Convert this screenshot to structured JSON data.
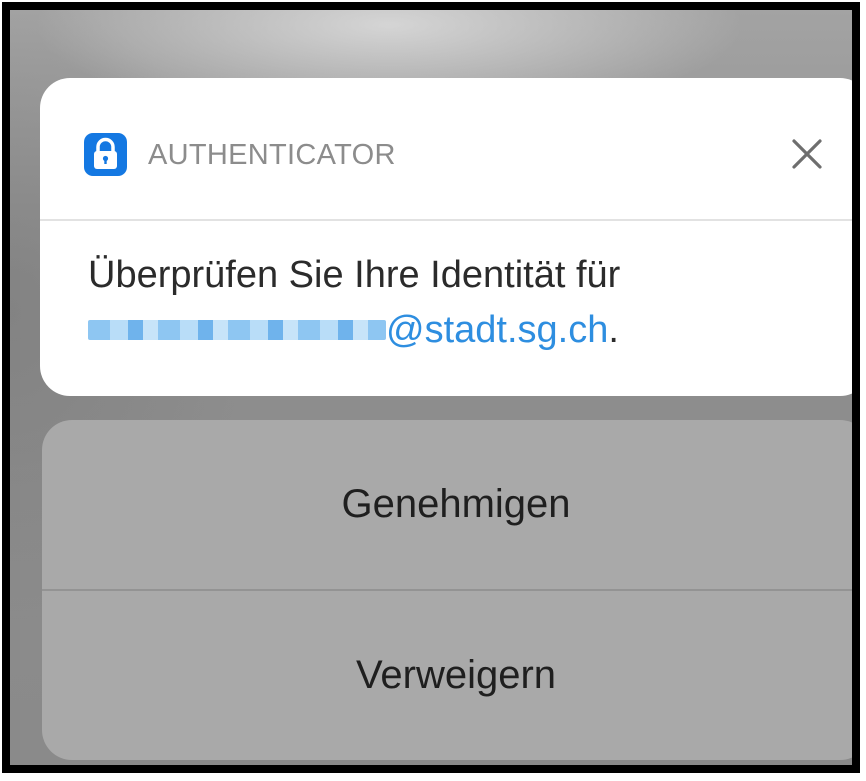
{
  "notification": {
    "app_name": "AUTHENTICATOR",
    "app_icon": "lock-icon",
    "close_icon": "close-icon",
    "message_line1": "Überprüfen Sie Ihre Identität für",
    "email_domain": "@stadt.sg.ch",
    "message_end": "."
  },
  "actions": {
    "approve_label": "Genehmigen",
    "deny_label": "Verweigern"
  },
  "colors": {
    "icon_background": "#1478e2",
    "link": "#2e8ee0",
    "app_name_text": "#8c8c8c"
  }
}
